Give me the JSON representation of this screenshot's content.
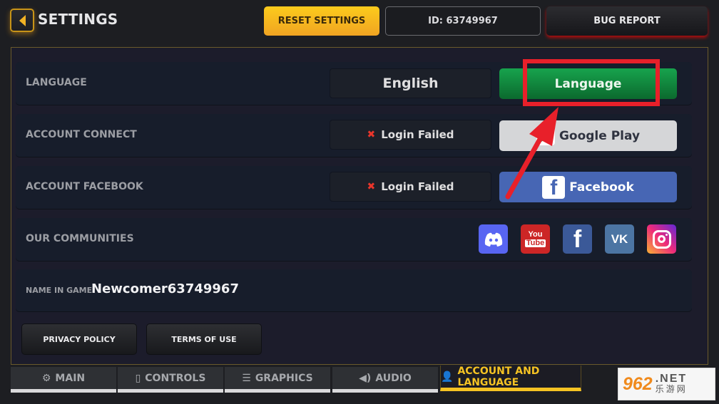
{
  "header": {
    "title": "SETTINGS",
    "reset_label": "RESET SETTINGS",
    "id_text": "ID: 63749967",
    "bug_report_label": "BUG REPORT"
  },
  "rows": {
    "language": {
      "label": "LANGUAGE",
      "value": "English",
      "button_label": "Language"
    },
    "account_connect": {
      "label": "ACCOUNT CONNECT",
      "status": "Login Failed",
      "button_label": "Google Play"
    },
    "account_facebook": {
      "label": "ACCOUNT FACEBOOK",
      "status": "Login Failed",
      "button_label": "Facebook"
    },
    "communities": {
      "label": "OUR COMMUNITIES",
      "icons": [
        "discord-icon",
        "youtube-icon",
        "facebook-icon",
        "vk-icon",
        "instagram-icon"
      ],
      "youtube_top": "You",
      "youtube_bottom": "Tube",
      "vk_text": "VK"
    },
    "name": {
      "label": "NAME IN GAME:",
      "value": "Newcomer63749967"
    }
  },
  "footer_buttons": {
    "privacy": "PRIVACY POLICY",
    "terms": "TERMS OF USE"
  },
  "tabs": [
    {
      "label": "MAIN",
      "icon": "gear-icon",
      "active": false
    },
    {
      "label": "CONTROLS",
      "icon": "touch-device-icon",
      "active": false
    },
    {
      "label": "GRAPHICS",
      "icon": "sliders-icon",
      "active": false
    },
    {
      "label": "AUDIO",
      "icon": "speaker-icon",
      "active": false
    },
    {
      "label": "ACCOUNT AND LANGUAGE",
      "icon": "user-icon",
      "active": true
    }
  ],
  "watermark": {
    "number": "962",
    "suffix": ".NET",
    "chinese": "乐游网"
  },
  "colors": {
    "accent_yellow": "#f5c323",
    "language_green": "#17a34d",
    "facebook_blue": "#4766b4",
    "annotation_red": "#e8202a"
  }
}
